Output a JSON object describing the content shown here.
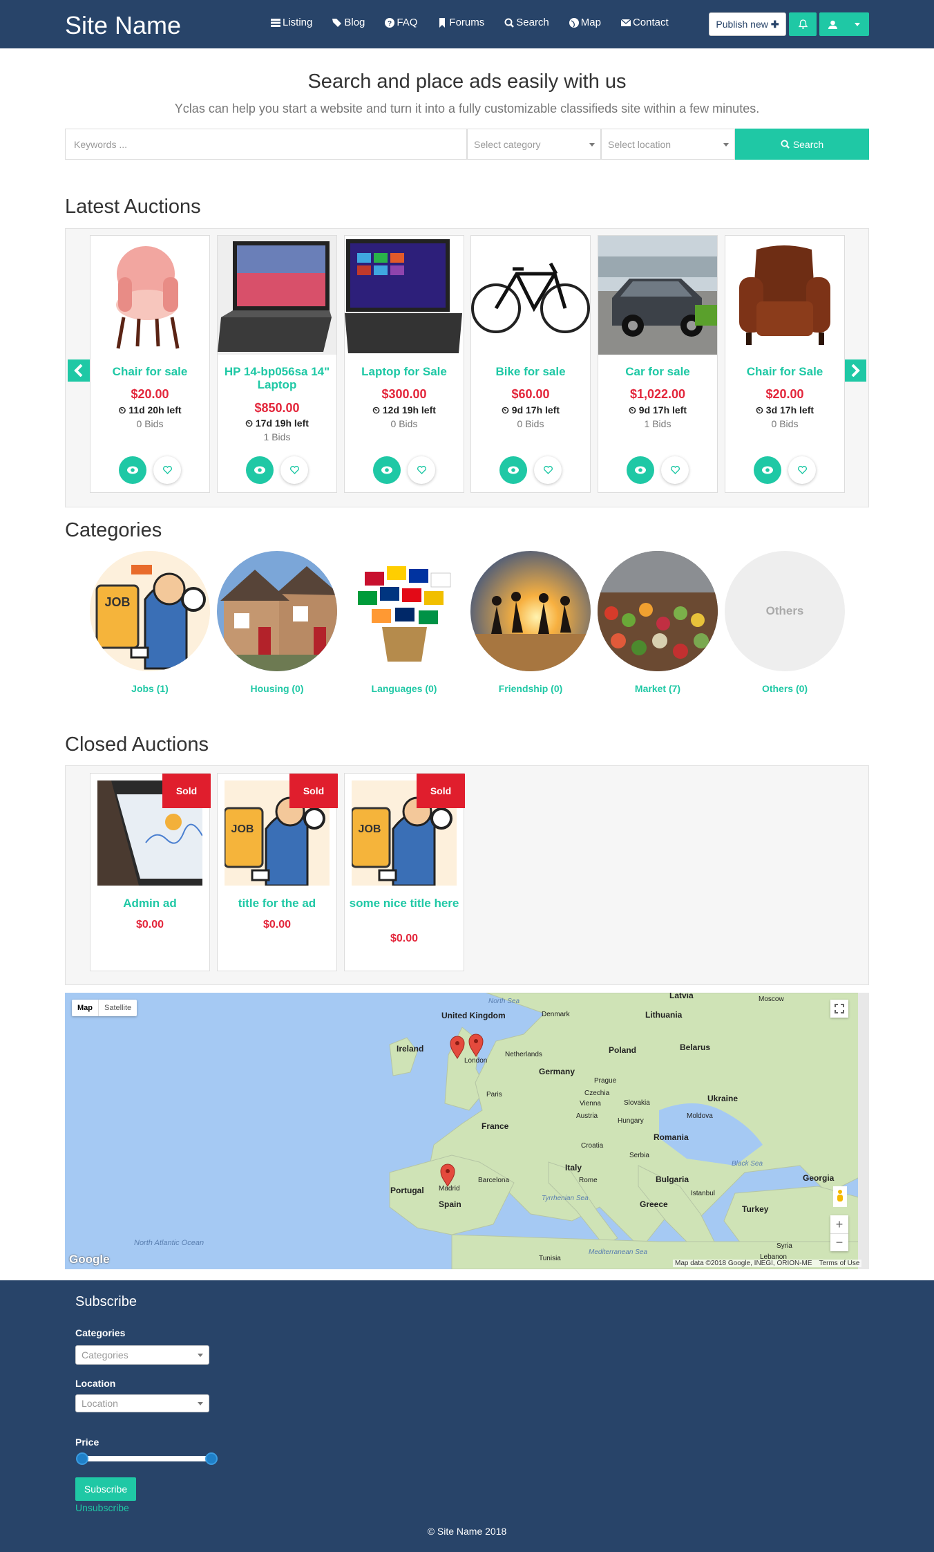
{
  "header": {
    "brand": "Site Name",
    "nav": [
      {
        "label": "Listing",
        "icon": "list-icon"
      },
      {
        "label": "Blog",
        "icon": "tags-icon"
      },
      {
        "label": "FAQ",
        "icon": "question-icon"
      },
      {
        "label": "Forums",
        "icon": "bookmark-icon"
      },
      {
        "label": "Search",
        "icon": "search-icon"
      },
      {
        "label": "Map",
        "icon": "globe-icon"
      },
      {
        "label": "Contact",
        "icon": "envelope-icon"
      }
    ],
    "publish_label": "Publish new"
  },
  "hero": {
    "title": "Search and place ads easily with us",
    "subtitle": "Yclas can help you start a website and turn it into a fully customizable classifieds site within a few minutes.",
    "keywords_placeholder": "Keywords ...",
    "category_placeholder": "Select category",
    "location_placeholder": "Select location",
    "search_label": "Search"
  },
  "latest": {
    "title": "Latest Auctions",
    "items": [
      {
        "title": "Chair for sale",
        "price": "$20.00",
        "time": "11d 20h left",
        "bids": "0 Bids"
      },
      {
        "title": "HP 14-bp056sa 14\" Laptop",
        "price": "$850.00",
        "time": "17d 19h left",
        "bids": "1 Bids"
      },
      {
        "title": "Laptop for Sale",
        "price": "$300.00",
        "time": "12d 19h left",
        "bids": "0 Bids"
      },
      {
        "title": "Bike for sale",
        "price": "$60.00",
        "time": "9d 17h left",
        "bids": "0 Bids"
      },
      {
        "title": "Car for sale",
        "price": "$1,022.00",
        "time": "9d 17h left",
        "bids": "1 Bids"
      },
      {
        "title": "Chair for Sale",
        "price": "$20.00",
        "time": "3d 17h left",
        "bids": "0 Bids"
      }
    ]
  },
  "categories": {
    "title": "Categories",
    "items": [
      {
        "label": "Jobs (1)"
      },
      {
        "label": "Housing (0)"
      },
      {
        "label": "Languages (0)"
      },
      {
        "label": "Friendship (0)"
      },
      {
        "label": "Market (7)"
      },
      {
        "label": "Others (0)",
        "placeholder": "Others"
      }
    ]
  },
  "closed": {
    "title": "Closed Auctions",
    "badge": "Sold",
    "items": [
      {
        "title": "Admin ad",
        "price": "$0.00"
      },
      {
        "title": "title for the ad",
        "price": "$0.00"
      },
      {
        "title": "some nice title here",
        "price": "$0.00"
      }
    ]
  },
  "map": {
    "tab_map": "Map",
    "tab_satellite": "Satellite",
    "labels": [
      "North Sea",
      "Latvia",
      "Moscow",
      "United Kingdom",
      "Denmark",
      "Lithuania",
      "Ireland",
      "Netherlands",
      "Poland",
      "Belarus",
      "London",
      "Germany",
      "Prague",
      "Paris",
      "Czechia",
      "Slovakia",
      "Ukraine",
      "Vienna",
      "Austria",
      "Hungary",
      "Moldova",
      "France",
      "Romania",
      "Croatia",
      "Serbia",
      "Black Sea",
      "Italy",
      "Bulgaria",
      "Georgia",
      "Portugal",
      "Madrid",
      "Barcelona",
      "Rome",
      "Spain",
      "Tyrrhenian Sea",
      "Greece",
      "Istanbul",
      "Turkey",
      "Syria",
      "North Atlantic Ocean",
      "Tunisia",
      "Mediterranean Sea",
      "Lebanon"
    ],
    "attribution": "Map data ©2018 Google, INEGI, ORION-ME",
    "terms": "Terms of Use",
    "logo": "Google"
  },
  "footer": {
    "subscribe_title": "Subscribe",
    "categories_label": "Categories",
    "categories_placeholder": "Categories",
    "location_label": "Location",
    "location_placeholder": "Location",
    "price_label": "Price",
    "subscribe_button": "Subscribe",
    "unsubscribe": "Unsubscribe",
    "copyright": "© Site Name 2018"
  },
  "colors": {
    "navy": "#284469",
    "accent": "#1fc8a5",
    "price": "#e3263b",
    "sold": "#e01e2d"
  }
}
